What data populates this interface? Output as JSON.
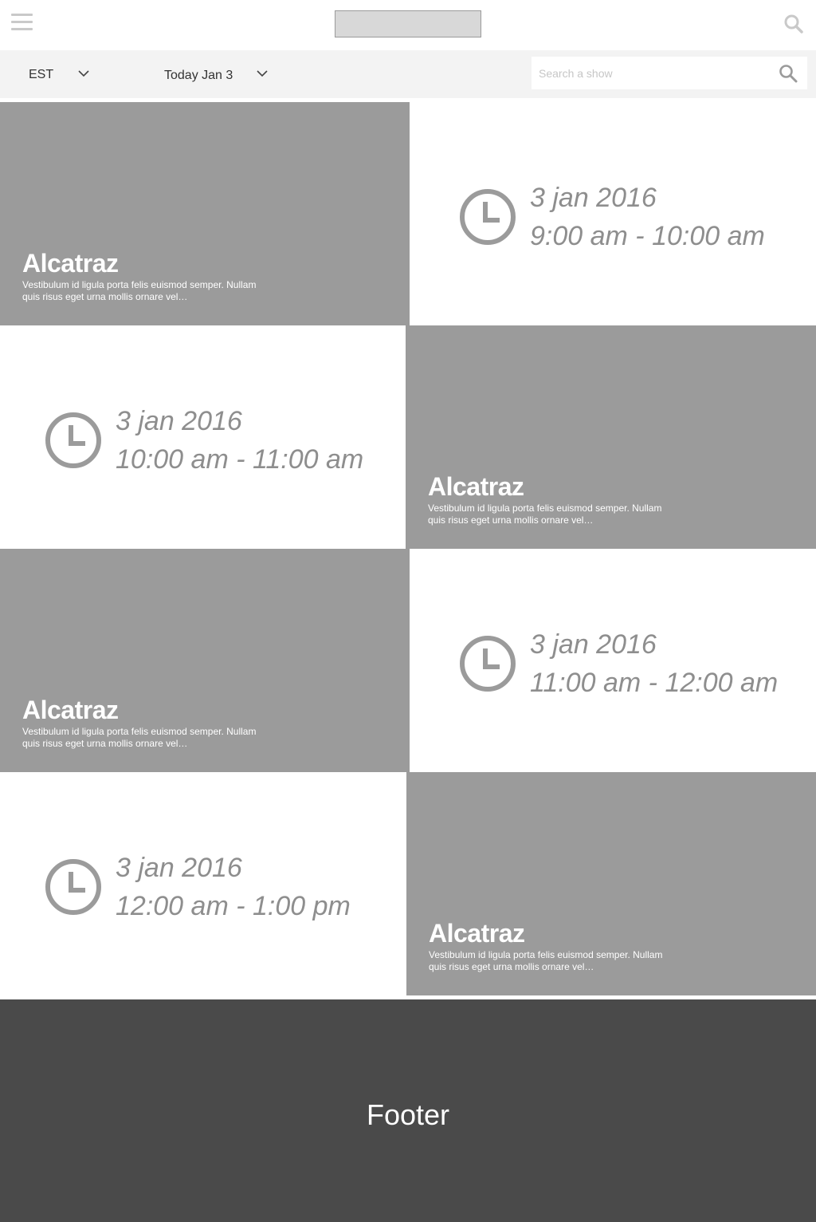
{
  "header": {
    "menu_icon": "hamburger-menu-icon",
    "logo": "logo-placeholder",
    "search_icon": "search-icon"
  },
  "filters": {
    "timezone": "EST",
    "date": "Today Jan 3",
    "search_placeholder": "Search a show",
    "search_value": ""
  },
  "schedule": [
    {
      "show": {
        "title": "Alcatraz",
        "description": "Vestibulum id ligula porta felis euismod semper. Nullam quis risus eget urna mollis ornare vel…"
      },
      "date": "3 jan 2016",
      "time_range": "9:00 am - 10:00 am"
    },
    {
      "show": {
        "title": "Alcatraz",
        "description": "Vestibulum id ligula porta felis euismod semper. Nullam quis risus eget urna mollis ornare vel…"
      },
      "date": "3 jan 2016",
      "time_range": "10:00 am - 11:00 am"
    },
    {
      "show": {
        "title": "Alcatraz",
        "description": "Vestibulum id ligula porta felis euismod semper. Nullam quis risus eget urna mollis ornare vel…"
      },
      "date": "3 jan 2016",
      "time_range": "11:00 am - 12:00 am"
    },
    {
      "show": {
        "title": "Alcatraz",
        "description": "Vestibulum id ligula porta felis euismod semper. Nullam quis risus eget urna mollis ornare vel…"
      },
      "date": "3 jan 2016",
      "time_range": "12:00 am - 1:00 pm"
    }
  ],
  "footer": {
    "label": "Footer"
  },
  "colors": {
    "show_card_bg": "#9b9b9b",
    "time_text": "#8e8e8e",
    "footer_bg": "#4a4a4a",
    "filterbar_bg": "#f3f3f3"
  }
}
